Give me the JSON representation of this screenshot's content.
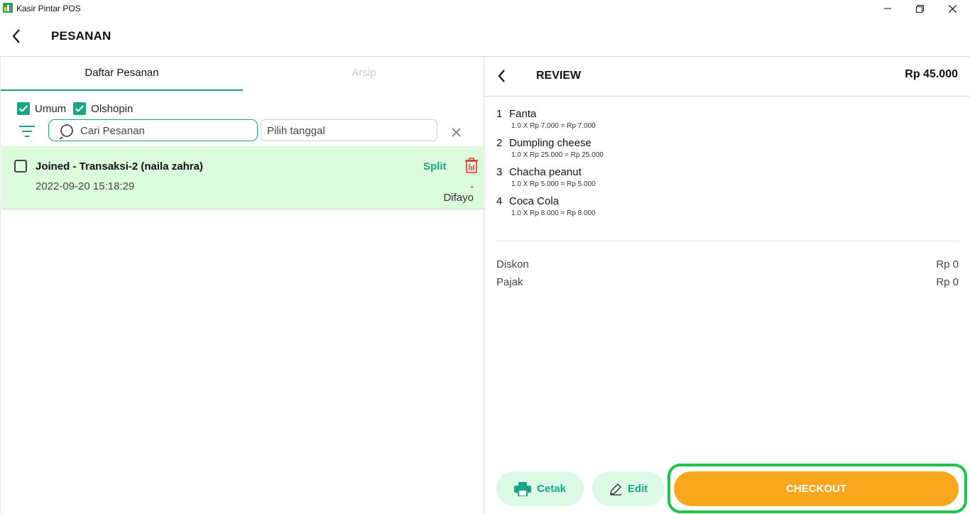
{
  "window": {
    "title": "Kasir Pintar POS"
  },
  "header": {
    "title": "PESANAN"
  },
  "tabs": [
    {
      "label": "Daftar Pesanan",
      "active": true
    },
    {
      "label": "Arsip",
      "active": false
    }
  ],
  "filters": {
    "checkboxes": [
      {
        "label": "Umum",
        "checked": true
      },
      {
        "label": "Olshopin",
        "checked": true
      }
    ],
    "search_placeholder": "Cari Pesanan",
    "date_placeholder": "Pilih tanggal"
  },
  "orders": [
    {
      "title": "Joined - Transaksi-2 (naila zahra)",
      "datetime": "2022-09-20 15:18:29",
      "split_label": "Split",
      "dash": "-",
      "cashier": "Difayo"
    }
  ],
  "review": {
    "title": "REVIEW",
    "total": "Rp 45.000",
    "items": [
      {
        "num": "1",
        "name": "Fanta",
        "detail": "1.0 X Rp 7.000 = Rp 7.000"
      },
      {
        "num": "2",
        "name": "Dumpling cheese",
        "detail": "1.0 X Rp 25.000 = Rp 25.000"
      },
      {
        "num": "3",
        "name": "Chacha peanut",
        "detail": "1.0 X Rp 5.000 = Rp 5.000"
      },
      {
        "num": "4",
        "name": "Coca Cola",
        "detail": "1.0 X Rp 8.000 = Rp 8.000"
      }
    ],
    "summary": [
      {
        "label": "Diskon",
        "value": "Rp 0"
      },
      {
        "label": "Pajak",
        "value": "Rp 0"
      }
    ],
    "buttons": {
      "print": "Cetak",
      "edit": "Edit",
      "checkout": "CHECKOUT"
    }
  },
  "colors": {
    "accent": "#1aa582",
    "row_highlight": "#dcfadc",
    "checkout": "#f9a81d",
    "checkout_outline": "#1fc24a",
    "delete": "#d9302c"
  }
}
